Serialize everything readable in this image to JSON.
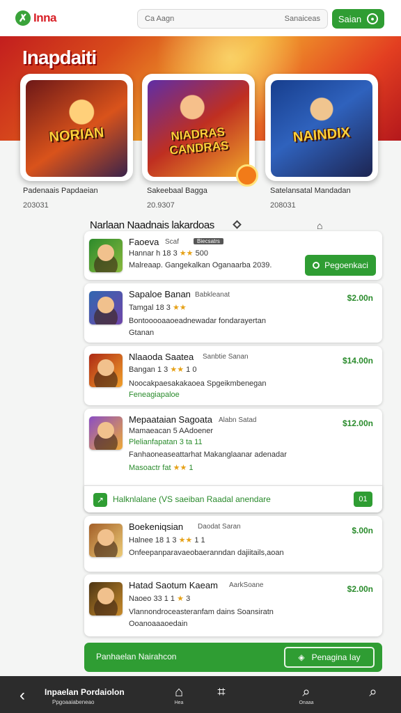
{
  "header": {
    "logo_text": "Inna",
    "search_left": "Ca Aagn",
    "search_placeholder": "Sanaiceas",
    "signin_label": "Saian"
  },
  "hero": {
    "title": "Inapdaiti",
    "features": [
      {
        "art_word": "NORIAN",
        "art_sub": "",
        "title": "Padenaais Papdaeian",
        "date": "203031"
      },
      {
        "art_word": "NIADRAS CANDRAS",
        "art_sub": "",
        "title": "Sakeebaal Bagga",
        "date": "20.9307"
      },
      {
        "art_word": "NAINDIX",
        "art_sub": "",
        "title": "Satelansatal Mandadan",
        "date": "208031"
      }
    ]
  },
  "list": {
    "title": "Narlaan Naadnais lakardoas",
    "items": [
      {
        "name": "Faoeva",
        "developer": "Scaf",
        "tag": "Biecsatrs",
        "rating_text": "Hannar h 18 3",
        "stars": "★★",
        "rating_extra": "500",
        "desc": "Malreaap. Gangekalkan Oganaarba 2039.",
        "button": "Pegoenkaci"
      },
      {
        "name": "Sapaloe Banan",
        "developer": "Babkleanat",
        "price": "$2.00n",
        "rating_text": "Tamgal 18 3",
        "stars": "★★",
        "desc1": "Bontooooaaoeadnewadar fondarayertan",
        "desc2": "Gtanan"
      },
      {
        "name": "Nlaaoda Saatea",
        "developer": "Sanbtie Sanan",
        "price": "$14.00n",
        "rating_text": "Bangan 1 3",
        "stars": "★★",
        "rating_extra": "1 0",
        "desc1": "Noocakpaesakakaoea Spgeikmbenegan",
        "desc2": "Feneagiapaloe"
      },
      {
        "name": "Mepaataian Sagoata",
        "developer": "Alabn Satad",
        "price": "$12.00n",
        "line1": "Mamaeacan 5 AAdoener",
        "line2": "Plelianfapatan 3 ta 11",
        "line3": "Fanhaoneaseattarhat Makanglaanar adenadar",
        "rating_text": "Masoactr fat",
        "stars": "★★",
        "rating_extra": "1",
        "promo_text": "Halknlalane (VS saeiban Raadal anendare",
        "promo_badge": "01"
      },
      {
        "name": "Boekeniqsian",
        "developer": "Daodat Saran",
        "price": "$.00n",
        "rating_text": "Halnee 18 1 3",
        "stars": "★★",
        "rating_extra": "1 1",
        "desc": "Onfeepanparavaeobaeranndan dajiitails,aoan"
      },
      {
        "name": "Hatad Saotum Kaeam",
        "developer": "AarkSoane",
        "price": "$2.00n",
        "rating_text": "Naoeo 33 1 1",
        "stars": "★",
        "rating_extra": "3",
        "desc1": "Vlannondroceasteranfam dains Soansiratn",
        "desc2": "Ooanoaaaoedain"
      }
    ],
    "cta_left": "Panhaelan Nairahcon",
    "cta_button": "Penagina Iay"
  },
  "nav": {
    "back": "‹",
    "title": "Inpaelan Pordaiolon",
    "subtitle": "Ppgoaaiabeneao",
    "items": [
      {
        "icon": "⌂",
        "label": "Hea"
      },
      {
        "icon": "⌗",
        "label": ""
      },
      {
        "icon": "⌕",
        "label": "Onaaa"
      },
      {
        "icon": "⌕",
        "label": ""
      }
    ]
  },
  "colors": {
    "accent_green": "#2f9d33",
    "brand_red": "#d81f26",
    "rating_star": "#e6a117"
  },
  "icons": {
    "logo": "leaf-logo-icon",
    "search": "search-icon",
    "user": "user-icon",
    "diamond": "diamond-icon",
    "share": "share-icon"
  }
}
